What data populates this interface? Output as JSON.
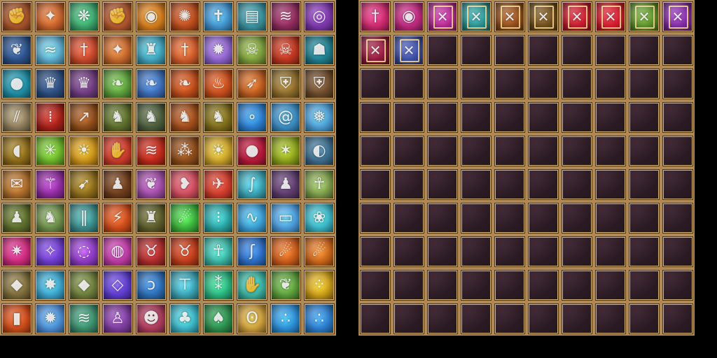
{
  "skills_panel": {
    "columns": 10,
    "rows": 10,
    "icons": [
      {
        "name": "fist-fire-icon",
        "color": "#a6532a"
      },
      {
        "name": "phoenix-icon",
        "color": "#c2602a"
      },
      {
        "name": "wind-leaf-icon",
        "color": "#3aa36a"
      },
      {
        "name": "fist-fire-icon",
        "color": "#b0562e"
      },
      {
        "name": "eye-icon",
        "color": "#d07a1e"
      },
      {
        "name": "fire-wings-icon",
        "color": "#b44a1c"
      },
      {
        "name": "holy-cross-icon",
        "color": "#3f8fc8"
      },
      {
        "name": "tome-icon",
        "color": "#3a8f9c"
      },
      {
        "name": "claw-icon",
        "color": "#8a2a5a"
      },
      {
        "name": "magic-circle-icon",
        "color": "#7a36a8"
      },
      {
        "name": "raven-icon",
        "color": "#2a4f86"
      },
      {
        "name": "wind-slash-icon",
        "color": "#5aa8c8"
      },
      {
        "name": "sword-icon",
        "color": "#c2462a"
      },
      {
        "name": "phoenix-icon",
        "color": "#c0652a"
      },
      {
        "name": "castle-wall-icon",
        "color": "#3fa0b8"
      },
      {
        "name": "sword-icon",
        "color": "#cc5a2a"
      },
      {
        "name": "light-burst-icon",
        "color": "#8a62c8"
      },
      {
        "name": "skull-icon",
        "color": "#7a9a3a"
      },
      {
        "name": "skull-mask-icon",
        "color": "#b8341e"
      },
      {
        "name": "shadow-figure-icon",
        "color": "#1f7a8a"
      },
      {
        "name": "orb-icon",
        "color": "#1f8aa0"
      },
      {
        "name": "crown-dark-icon",
        "color": "#2a4a7a"
      },
      {
        "name": "crown-dark-icon",
        "color": "#6a3a7a"
      },
      {
        "name": "dragon-head-icon",
        "color": "#5a9a3a"
      },
      {
        "name": "dragon-head-icon",
        "color": "#3a6ab0"
      },
      {
        "name": "dragon-head-icon",
        "color": "#b84a1a"
      },
      {
        "name": "fire-ground-icon",
        "color": "#c04a1a"
      },
      {
        "name": "arrow-icon",
        "color": "#b85a1e"
      },
      {
        "name": "armor-icon",
        "color": "#8a6a2a"
      },
      {
        "name": "armor-icon",
        "color": "#6a4a2a"
      },
      {
        "name": "scratch-icon",
        "color": "#8a7a5a"
      },
      {
        "name": "blood-rain-icon",
        "color": "#a02018"
      },
      {
        "name": "spear-icon",
        "color": "#8a4a1a"
      },
      {
        "name": "warrior-icon",
        "color": "#5a6a2a"
      },
      {
        "name": "warrior-icon",
        "color": "#4a5a3a"
      },
      {
        "name": "warrior-icon",
        "color": "#9a4a1a"
      },
      {
        "name": "warrior-icon",
        "color": "#7a6a1a"
      },
      {
        "name": "water-orbs-icon",
        "color": "#2a7ac8"
      },
      {
        "name": "whirlpool-icon",
        "color": "#3a8ac0"
      },
      {
        "name": "ice-wave-icon",
        "color": "#4a9ad0"
      },
      {
        "name": "horn-icon",
        "color": "#8a6a1a"
      },
      {
        "name": "nature-burst-icon",
        "color": "#6ab02a"
      },
      {
        "name": "sun-burst-icon",
        "color": "#c8901a"
      },
      {
        "name": "hand-fire-icon",
        "color": "#c83a2a"
      },
      {
        "name": "claw-slash-icon",
        "color": "#b8281a"
      },
      {
        "name": "sparks-icon",
        "color": "#8a4a1a"
      },
      {
        "name": "sun-burst-icon",
        "color": "#c8a02a"
      },
      {
        "name": "blood-drop-icon",
        "color": "#b01838"
      },
      {
        "name": "light-rays-icon",
        "color": "#8aa01a"
      },
      {
        "name": "eyes-icon",
        "color": "#3a6a8a"
      },
      {
        "name": "scroll-icon",
        "color": "#a86a2a"
      },
      {
        "name": "staff-icon",
        "color": "#8a2a9a"
      },
      {
        "name": "bow-icon",
        "color": "#8a6a1a"
      },
      {
        "name": "hooded-figure-icon",
        "color": "#6a3a1a"
      },
      {
        "name": "feather-icon",
        "color": "#9a4aa0"
      },
      {
        "name": "wing-icon",
        "color": "#c84a5a"
      },
      {
        "name": "black-wings-icon",
        "color": "#c83a2a"
      },
      {
        "name": "tentacle-icon",
        "color": "#3aa0b0"
      },
      {
        "name": "hooded-figure-icon",
        "color": "#5a3a6a"
      },
      {
        "name": "skeleton-icon",
        "color": "#7a9a4a"
      },
      {
        "name": "hooded-archer-icon",
        "color": "#5a6a2a"
      },
      {
        "name": "knight-helm-icon",
        "color": "#6a8a4a"
      },
      {
        "name": "waterfall-icon",
        "color": "#3a8a8a"
      },
      {
        "name": "fire-slash-icon",
        "color": "#c84a1a"
      },
      {
        "name": "golem-icon",
        "color": "#5a5a2a"
      },
      {
        "name": "comet-icon",
        "color": "#3ab03a"
      },
      {
        "name": "light-rain-icon",
        "color": "#2aa0a0"
      },
      {
        "name": "wave-icon",
        "color": "#3a9ad0"
      },
      {
        "name": "open-book-icon",
        "color": "#4a9ad8"
      },
      {
        "name": "angel-wings-icon",
        "color": "#3ab0c0"
      },
      {
        "name": "pink-burst-icon",
        "color": "#c82a7a"
      },
      {
        "name": "star-field-icon",
        "color": "#6a3ac8"
      },
      {
        "name": "vortex-icon",
        "color": "#8a3ac0"
      },
      {
        "name": "magic-orb-icon",
        "color": "#b83aa0"
      },
      {
        "name": "demon-icon",
        "color": "#a82a2a"
      },
      {
        "name": "demon-icon",
        "color": "#b83a1a"
      },
      {
        "name": "ankh-icon",
        "color": "#3ab0a0"
      },
      {
        "name": "hook-icon",
        "color": "#2a6ac0"
      },
      {
        "name": "fireball-icon",
        "color": "#c85a1a"
      },
      {
        "name": "fireball-icon",
        "color": "#c8641a"
      },
      {
        "name": "rock-icon",
        "color": "#7a6a3a"
      },
      {
        "name": "light-star-icon",
        "color": "#3aa0c8"
      },
      {
        "name": "rock-icon",
        "color": "#6a7a3a"
      },
      {
        "name": "crystal-icon",
        "color": "#5a3ac8"
      },
      {
        "name": "spiral-icon",
        "color": "#2a6ab0"
      },
      {
        "name": "holy-pillar-icon",
        "color": "#3aa0b0"
      },
      {
        "name": "light-pillar-icon",
        "color": "#2ab07a"
      },
      {
        "name": "fire-hand-icon",
        "color": "#3ab0a0"
      },
      {
        "name": "feather-icon",
        "color": "#5a9a3a"
      },
      {
        "name": "golden-orbs-icon",
        "color": "#c89a1a"
      },
      {
        "name": "fire-pillar-icon",
        "color": "#c84a1a"
      },
      {
        "name": "light-burst-icon",
        "color": "#4a8ad0"
      },
      {
        "name": "wind-icon",
        "color": "#3a8a6a"
      },
      {
        "name": "hooded-mage-icon",
        "color": "#7a3a9a"
      },
      {
        "name": "demon-face-icon",
        "color": "#a83a5a"
      },
      {
        "name": "spirit-icon",
        "color": "#3ab0c0"
      },
      {
        "name": "forest-icon",
        "color": "#2a8a4a"
      },
      {
        "name": "swirl-icon",
        "color": "#c89a3a"
      },
      {
        "name": "bubbles-icon",
        "color": "#2a8ad0"
      },
      {
        "name": "bubbles-icon",
        "color": "#2a7ac8"
      }
    ]
  },
  "bag_panel": {
    "columns": 10,
    "rows": 10,
    "items": [
      {
        "name": "sword-card-icon",
        "color": "#c8286a"
      },
      {
        "name": "glowing-eyes-card-icon",
        "color": "#b8287a"
      },
      {
        "name": "spellbook-icon",
        "color": "#a82a8a"
      },
      {
        "name": "spellbook-icon",
        "color": "#2a8a8a"
      },
      {
        "name": "spellbook-icon",
        "color": "#8a4a1a"
      },
      {
        "name": "spellbook-icon",
        "color": "#6a4a1a"
      },
      {
        "name": "spellbook-icon",
        "color": "#b81a2a"
      },
      {
        "name": "spellbook-icon",
        "color": "#c81a2a"
      },
      {
        "name": "spellbook-icon",
        "color": "#5a8a2a"
      },
      {
        "name": "spellbook-icon",
        "color": "#7a2a9a"
      },
      {
        "name": "spellbook-icon",
        "color": "#8a1a3a"
      },
      {
        "name": "spellbook-icon",
        "color": "#3a4a9a"
      }
    ]
  },
  "icon_glyphs": {
    "fist-fire-icon": "✊",
    "phoenix-icon": "✦",
    "wind-leaf-icon": "❋",
    "eye-icon": "◉",
    "fire-wings-icon": "✺",
    "holy-cross-icon": "✝",
    "tome-icon": "▤",
    "claw-icon": "≋",
    "magic-circle-icon": "◎",
    "raven-icon": "❦",
    "wind-slash-icon": "≈",
    "sword-icon": "†",
    "castle-wall-icon": "♜",
    "light-burst-icon": "✹",
    "skull-icon": "☠",
    "skull-mask-icon": "☠",
    "shadow-figure-icon": "☗",
    "orb-icon": "●",
    "crown-dark-icon": "♛",
    "dragon-head-icon": "❧",
    "fire-ground-icon": "♨",
    "arrow-icon": "➶",
    "armor-icon": "⛨",
    "scratch-icon": "⫽",
    "blood-rain-icon": "⁞",
    "spear-icon": "↗",
    "warrior-icon": "♞",
    "water-orbs-icon": "∘",
    "whirlpool-icon": "@",
    "ice-wave-icon": "❅",
    "horn-icon": "◖",
    "nature-burst-icon": "✳",
    "sun-burst-icon": "☀",
    "hand-fire-icon": "✋",
    "claw-slash-icon": "≋",
    "sparks-icon": "⁂",
    "blood-drop-icon": "●",
    "light-rays-icon": "✶",
    "eyes-icon": "◐",
    "scroll-icon": "✉",
    "staff-icon": "⚚",
    "bow-icon": "➹",
    "hooded-figure-icon": "♟",
    "feather-icon": "❦",
    "wing-icon": "❥",
    "black-wings-icon": "✈",
    "tentacle-icon": "∫",
    "skeleton-icon": "☥",
    "hooded-archer-icon": "♟",
    "knight-helm-icon": "♞",
    "waterfall-icon": "‖",
    "fire-slash-icon": "⚡",
    "golem-icon": "♜",
    "comet-icon": "☄",
    "light-rain-icon": "⁝",
    "wave-icon": "∿",
    "open-book-icon": "▭",
    "angel-wings-icon": "❀",
    "pink-burst-icon": "✷",
    "star-field-icon": "✧",
    "vortex-icon": "◌",
    "magic-orb-icon": "◍",
    "demon-icon": "♉",
    "ankh-icon": "☥",
    "hook-icon": "ʃ",
    "fireball-icon": "☄",
    "rock-icon": "◆",
    "light-star-icon": "✸",
    "crystal-icon": "◇",
    "spiral-icon": "ↄ",
    "holy-pillar-icon": "⊤",
    "light-pillar-icon": "⁑",
    "fire-hand-icon": "✋",
    "golden-orbs-icon": "⁘",
    "fire-pillar-icon": "▮",
    "wind-icon": "≋",
    "hooded-mage-icon": "♙",
    "demon-face-icon": "☻",
    "spirit-icon": "♣",
    "forest-icon": "♠",
    "swirl-icon": "ʘ",
    "bubbles-icon": "∴",
    "sword-card-icon": "†",
    "glowing-eyes-card-icon": "◉",
    "spellbook-icon": "✕"
  }
}
